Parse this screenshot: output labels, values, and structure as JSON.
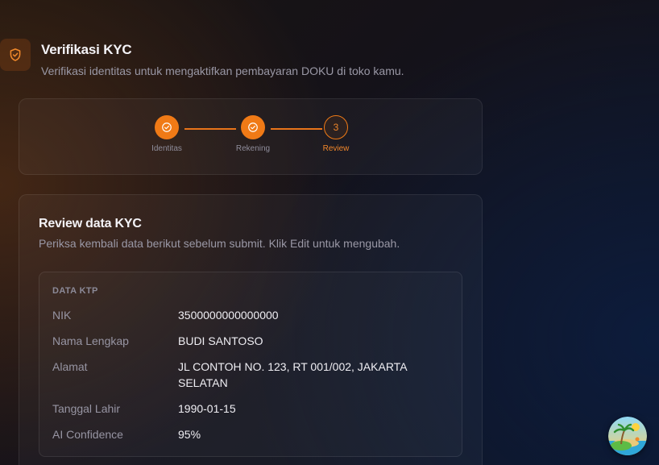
{
  "header": {
    "icon": "shield-check-icon",
    "title": "Verifikasi KYC",
    "subtitle": "Verifikasi identitas untuk mengaktifkan pembayaran DOKU di toko kamu."
  },
  "stepper": {
    "steps": [
      {
        "label": "Identitas",
        "status": "completed",
        "icon": "check-icon"
      },
      {
        "label": "Rekening",
        "status": "completed",
        "icon": "check-icon"
      },
      {
        "label": "Review",
        "status": "current",
        "number": "3"
      }
    ],
    "accent_color": "#f07a16"
  },
  "review": {
    "title": "Review data KYC",
    "subtitle": "Periksa kembali data berikut sebelum submit. Klik Edit untuk mengubah.",
    "ktp": {
      "heading": "DATA KTP",
      "rows": [
        {
          "label": "NIK",
          "value": "3500000000000000"
        },
        {
          "label": "Nama Lengkap",
          "value": "BUDI SANTOSO"
        },
        {
          "label": "Alamat",
          "value": "JL CONTOH NO. 123, RT 001/002, JAKARTA SELATAN"
        },
        {
          "label": "Tanggal Lahir",
          "value": "1990-01-15"
        },
        {
          "label": "AI Confidence",
          "value": "95%"
        }
      ]
    }
  },
  "floating": {
    "avatar_icon": "beach-island-avatar-icon"
  }
}
